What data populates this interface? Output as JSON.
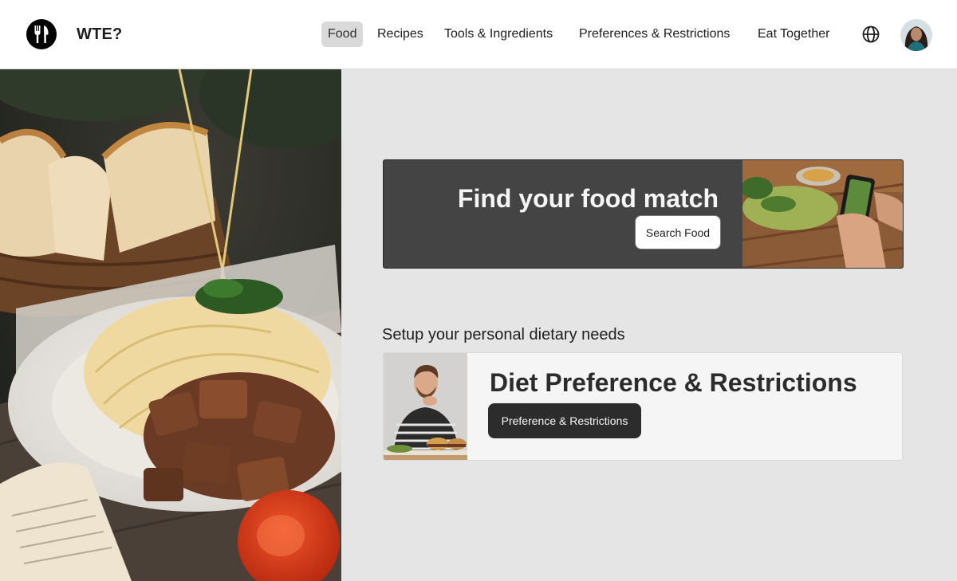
{
  "header": {
    "brand": "WTE?",
    "logo_icon": "fork-knife-icon",
    "nav": [
      {
        "label": "Food",
        "active": true
      },
      {
        "label": "Recipes",
        "active": false
      },
      {
        "label": "Tools & Ingredients",
        "active": false
      },
      {
        "label": "Preferences & Restrictions",
        "active": false
      },
      {
        "label": "Eat Together",
        "active": false
      }
    ],
    "language_icon": "globe-icon",
    "avatar_icon": "user-avatar"
  },
  "search_card": {
    "title": "Find your food match",
    "button_label": "Search Food"
  },
  "setup": {
    "label": "Setup your personal dietary needs",
    "card_title": "Diet Preference & Restrictions",
    "button_label": "Preference & Restrictions"
  },
  "colors": {
    "header_bg": "#ffffff",
    "page_bg": "#e5e5e5",
    "active_nav_bg": "#d9d9d9",
    "dark_card_bg": "#444444",
    "dark_button_bg": "#2c2c2c",
    "light_card_bg": "#f5f5f5"
  }
}
